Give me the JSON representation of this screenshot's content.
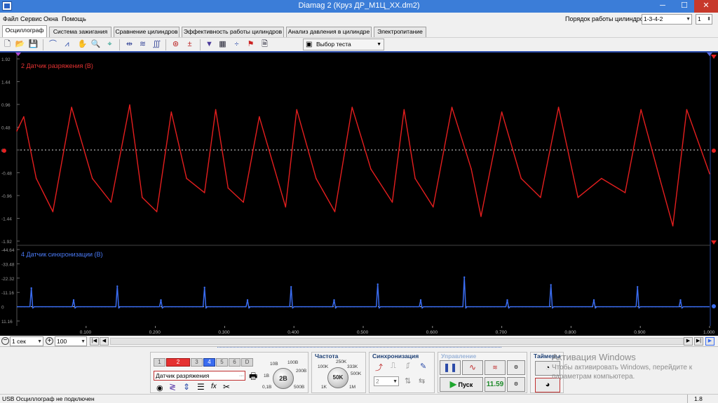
{
  "window": {
    "title": "Diamag 2 (Круз ДР_М1Ц_XX.dm2)"
  },
  "menu": {
    "items": [
      "Файл",
      "Сервис",
      "Окна",
      "Помощь"
    ]
  },
  "cylinder_order": {
    "label": "Порядок работы цилиндров",
    "value": "1-3-4-2",
    "count": "1"
  },
  "tabs": [
    "Осциллограф",
    "Система зажигания",
    "Сравнение цилиндров",
    "Эффективность работы цилиндров",
    "Анализ давления в цилиндре",
    "Электропитание"
  ],
  "toolbar": {
    "test_select": "Выбор теста"
  },
  "chart_data": [
    {
      "type": "line",
      "title": "2 Датчик разряжения (В)",
      "color": "#e41e1e",
      "y_ticks": [
        "-1.92",
        "-1.44",
        "-0.96",
        "-0.48",
        "0",
        "0.48",
        "0.96",
        "1.44",
        "1.92"
      ],
      "ylim": [
        1.92,
        -1.92
      ],
      "x": [
        0.0,
        0.01,
        0.028,
        0.052,
        0.079,
        0.109,
        0.136,
        0.163,
        0.181,
        0.202,
        0.223,
        0.245,
        0.271,
        0.287,
        0.305,
        0.327,
        0.35,
        0.372,
        0.388,
        0.404,
        0.432,
        0.459,
        0.484,
        0.511,
        0.542,
        0.559,
        0.575,
        0.601,
        0.628,
        0.656,
        0.67,
        0.7,
        0.728,
        0.756,
        0.782,
        0.81,
        0.844,
        0.878,
        0.901,
        0.928,
        0.947,
        0.967,
        1.0
      ],
      "values": [
        0.4,
        0.7,
        -0.6,
        -1.3,
        0.9,
        -0.6,
        -1.1,
        0.95,
        -1.0,
        -1.3,
        0.8,
        -0.6,
        -0.9,
        0.85,
        -0.8,
        -1.1,
        0.7,
        -0.4,
        -1.2,
        0.85,
        -0.6,
        -1.3,
        0.9,
        -0.4,
        -1.1,
        0.85,
        -0.6,
        -1.2,
        0.9,
        -0.4,
        -1.4,
        0.8,
        -0.6,
        -1.0,
        0.9,
        -1.0,
        -0.6,
        -0.9,
        0.85,
        -0.6,
        -1.6,
        0.85,
        -0.5
      ]
    },
    {
      "type": "line",
      "title": "4 Датчик синхронизации (В)",
      "color": "#3a6cf0",
      "y_ticks": [
        "-44.64",
        "-33.48",
        "-22.32",
        "-11.16",
        "0",
        "11.16"
      ],
      "ylim": [
        11.16,
        -44.64
      ],
      "xlim": [
        0,
        1
      ],
      "x_ticks": [
        "0.100",
        "0.200",
        "0.300",
        "0.400",
        "0.500",
        "0.600",
        "0.700",
        "0.800",
        "0.900",
        "1.000"
      ],
      "pulses": [
        {
          "x": 0.021,
          "y": -14.5
        },
        {
          "x": 0.082,
          "y": -5.2
        },
        {
          "x": 0.145,
          "y": -16.0
        },
        {
          "x": 0.208,
          "y": -5.2
        },
        {
          "x": 0.271,
          "y": -15.0
        },
        {
          "x": 0.333,
          "y": -5.2
        },
        {
          "x": 0.396,
          "y": -15.5
        },
        {
          "x": 0.458,
          "y": -5.2
        },
        {
          "x": 0.521,
          "y": -17.5
        },
        {
          "x": 0.583,
          "y": -5.2
        },
        {
          "x": 0.646,
          "y": -23.0
        },
        {
          "x": 0.708,
          "y": -5.2
        },
        {
          "x": 0.771,
          "y": -17.0
        },
        {
          "x": 0.833,
          "y": -5.2
        },
        {
          "x": 0.896,
          "y": -15.5
        },
        {
          "x": 0.958,
          "y": -5.2
        }
      ]
    }
  ],
  "bottom_nav": {
    "time_per_div": "1 сек",
    "zoom": "100"
  },
  "control_panel": {
    "channels": [
      "1",
      "2",
      "3",
      "4",
      "5",
      "6",
      "D"
    ],
    "sensor_select": "Датчик разряжения",
    "voltage": {
      "value": "2В",
      "labels": [
        "10В",
        "100В",
        "200В",
        "1В",
        "0,1В",
        "500В"
      ]
    },
    "frequency": {
      "title": "Частота",
      "value": "50K",
      "labels": [
        "250K",
        "100K",
        "333K",
        "500K",
        "1K",
        "1M"
      ]
    },
    "sync": {
      "title": "Синхронизация",
      "value": "2"
    },
    "control": {
      "title": "Управление",
      "start_label": "Пуск",
      "timer_value": "11.59"
    },
    "timers": {
      "title": "Таймеры"
    }
  },
  "watermark": {
    "line1": "Активация Windows",
    "line2": "Чтобы активировать Windows, перейдите к",
    "line3": "параметрам компьютера."
  },
  "statusbar": {
    "text": "USB Осциллограф не подключен",
    "version": "1.8"
  }
}
